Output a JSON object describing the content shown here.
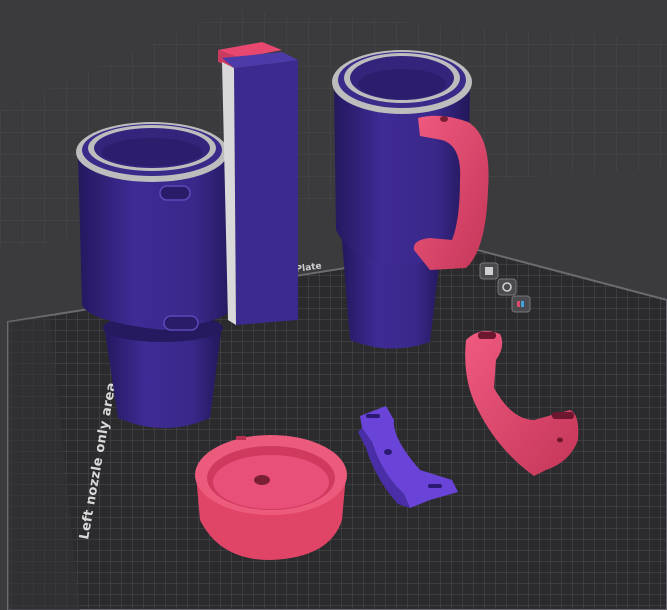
{
  "scene": {
    "plate_label": "Left nozzle only area",
    "plate_tag": "Plate",
    "colors": {
      "background": "#3b3b3e",
      "bed": "#2b2b2e",
      "bed_grid": "#55555a",
      "tumbler_body": "#3e2a8e",
      "tumbler_shade": "#2a1c68",
      "rim": "#bfbfbf",
      "handle": "#e84870",
      "handle_shade": "#b9304f",
      "clip": "#6a44d8"
    }
  },
  "plate_tools": [
    {
      "name": "pick-icon"
    },
    {
      "name": "settings-icon"
    },
    {
      "name": "lock-icon"
    }
  ]
}
